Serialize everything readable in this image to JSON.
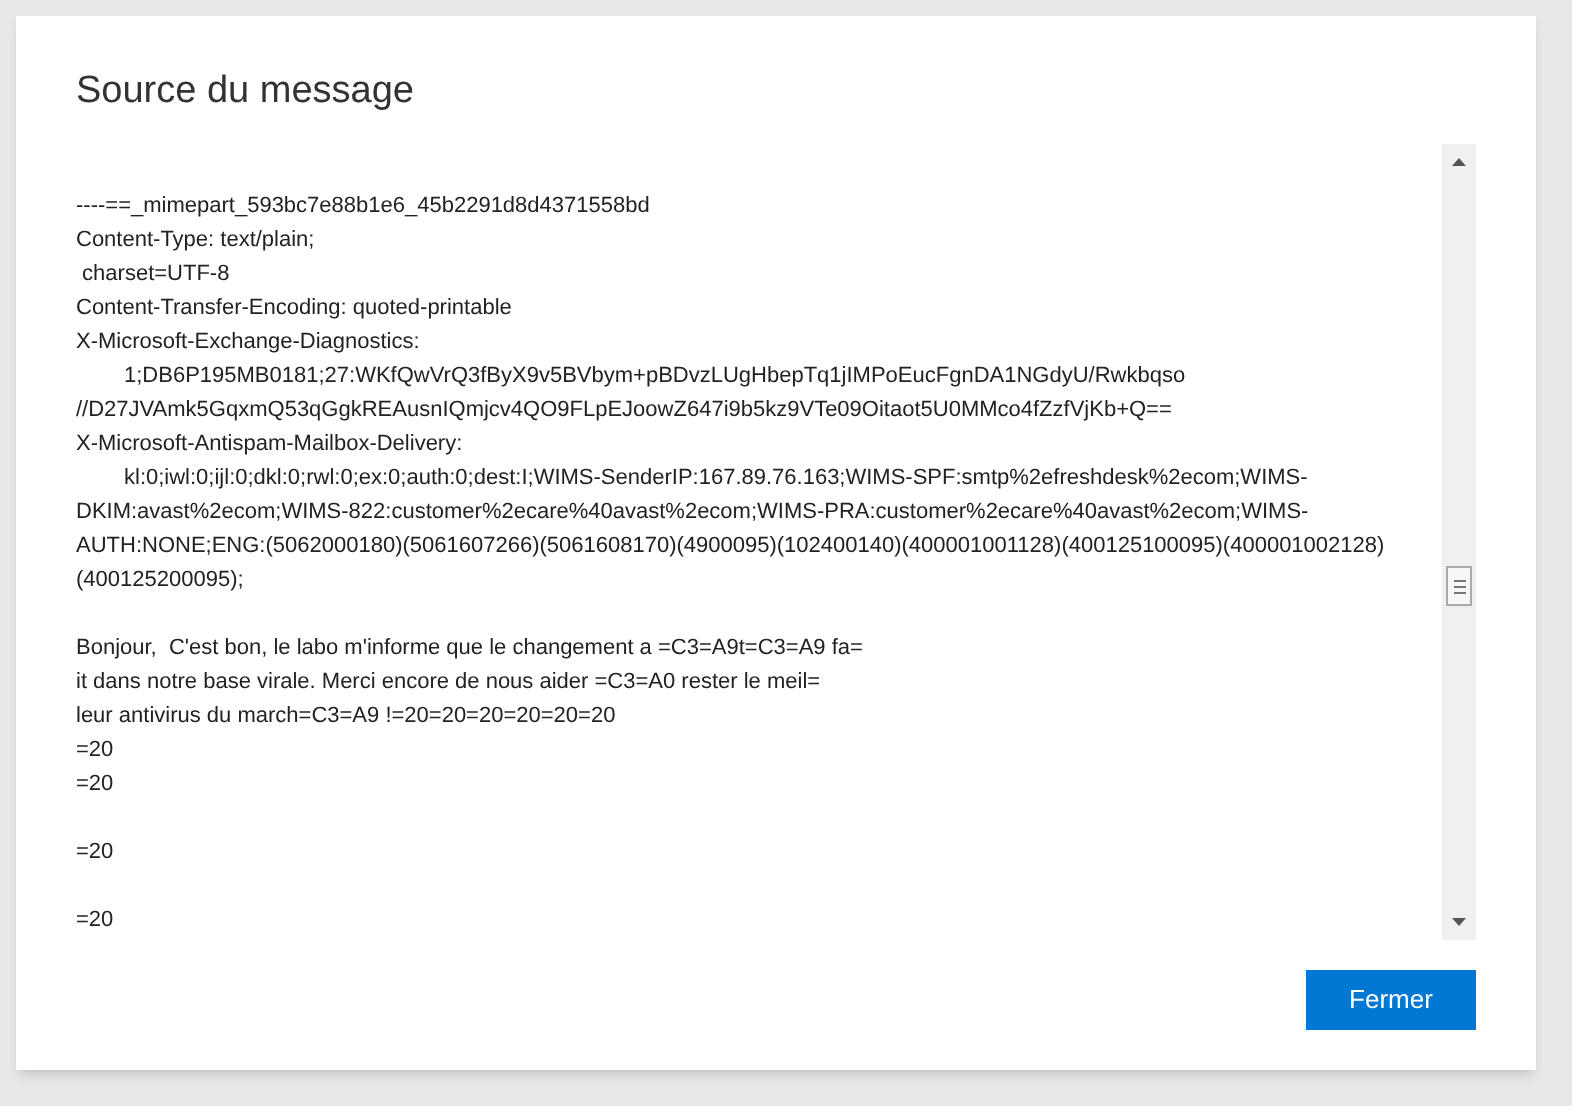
{
  "dialog": {
    "title": "Source du message",
    "lines": [
      {
        "kind": "text",
        "text": "----==_mimepart_593bc7e88b1e6_45b2291d8d4371558bd"
      },
      {
        "kind": "text",
        "text": "Content-Type: text/plain;"
      },
      {
        "kind": "text",
        "text": " charset=UTF-8"
      },
      {
        "kind": "text",
        "text": "Content-Transfer-Encoding: quoted-printable"
      },
      {
        "kind": "text",
        "text": "X-Microsoft-Exchange-Diagnostics:"
      },
      {
        "kind": "indent",
        "text": "1;DB6P195MB0181;27:WKfQwVrQ3fByX9v5BVbym+pBDvzLUgHbepTq1jIMPoEucFgnDA1NGdyU/Rwkbqso"
      },
      {
        "kind": "text",
        "text": "//D27JVAmk5GqxmQ53qGgkREAusnIQmjcv4QO9FLpEJoowZ647i9b5kz9VTe09Oitaot5U0MMco4fZzfVjKb+Q=="
      },
      {
        "kind": "text",
        "text": "X-Microsoft-Antispam-Mailbox-Delivery:"
      },
      {
        "kind": "indent",
        "text": "kl:0;iwl:0;ijl:0;dkl:0;rwl:0;ex:0;auth:0;dest:I;WIMS-SenderIP:167.89.76.163;WIMS-SPF:smtp%2efreshdesk%2ecom;WIMS-"
      },
      {
        "kind": "text",
        "text": "DKIM:avast%2ecom;WIMS-822:customer%2ecare%40avast%2ecom;WIMS-PRA:customer%2ecare%40avast%2ecom;WIMS-"
      },
      {
        "kind": "text",
        "text": "AUTH:NONE;ENG:(5062000180)(5061607266)(5061608170)(4900095)(102400140)(400001001128)(400125100095)(400001002128)"
      },
      {
        "kind": "text",
        "text": "(400125200095);"
      },
      {
        "kind": "blank"
      },
      {
        "kind": "text",
        "text": "Bonjour,  C'est bon, le labo m'informe que le changement a =C3=A9t=C3=A9 fa="
      },
      {
        "kind": "text",
        "text": "it dans notre base virale. Merci encore de nous aider =C3=A0 rester le meil="
      },
      {
        "kind": "text",
        "text": "leur antivirus du march=C3=A9 !=20=20=20=20=20=20"
      },
      {
        "kind": "text",
        "text": "=20"
      },
      {
        "kind": "text",
        "text": "=20"
      },
      {
        "kind": "blank"
      },
      {
        "kind": "text",
        "text": "=20"
      },
      {
        "kind": "blank"
      },
      {
        "kind": "text",
        "text": "=20"
      }
    ],
    "close_button": "Fermer"
  }
}
